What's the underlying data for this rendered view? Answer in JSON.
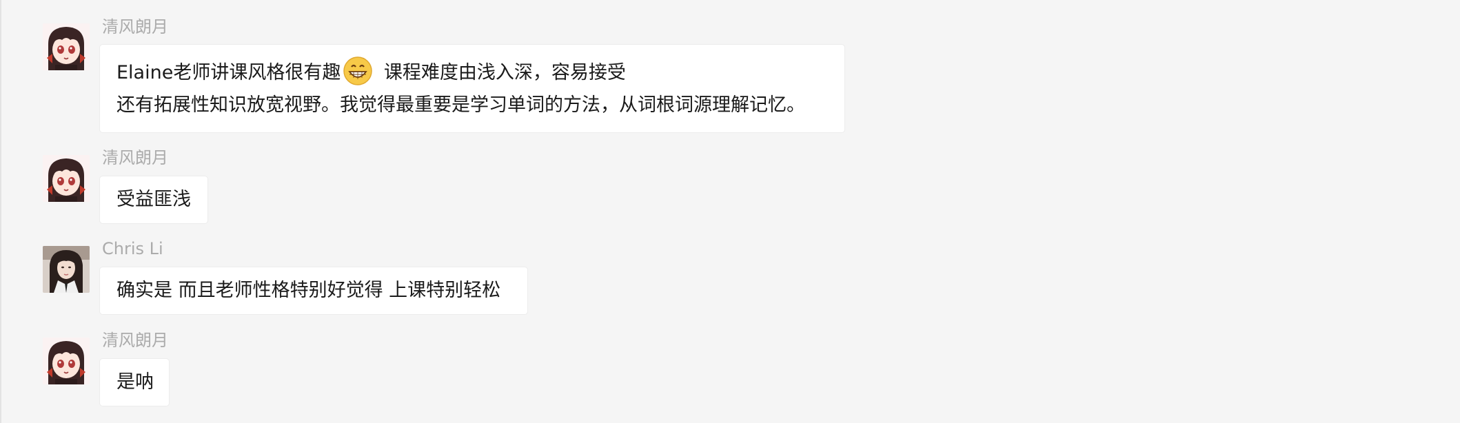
{
  "messages": [
    {
      "sender": "清风朗月",
      "avatar": "anime-girl-avatar",
      "lines": [
        {
          "pre": "Elaine老师讲课风格很有趣",
          "emoji": "grinning-face-emoji",
          "post": " 课程难度由浅入深，容易接受"
        },
        {
          "pre": "还有拓展性知识放宽视野。我觉得最重要是学习单词的方法，从词根词源理解记忆。"
        }
      ]
    },
    {
      "sender": "清风朗月",
      "avatar": "anime-girl-avatar",
      "lines": [
        {
          "pre": "受益匪浅"
        }
      ]
    },
    {
      "sender": "Chris Li",
      "avatar": "photo-avatar",
      "lines": [
        {
          "pre": "确实是 而且老师性格特别好觉得 上课特别轻松"
        }
      ]
    },
    {
      "sender": "清风朗月",
      "avatar": "anime-girl-avatar",
      "lines": [
        {
          "pre": "是呐"
        }
      ]
    }
  ],
  "colors": {
    "background": "#f5f5f5",
    "bubble": "#ffffff",
    "sender_name": "#ababab",
    "text": "#1a1a1a"
  }
}
